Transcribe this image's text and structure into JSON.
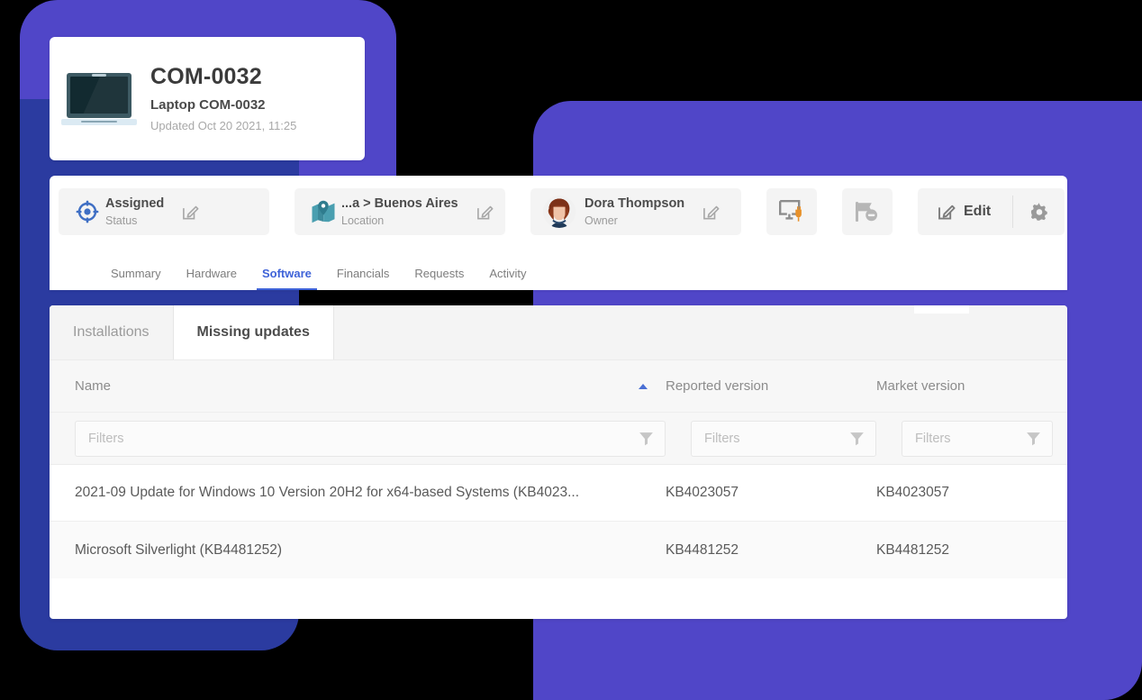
{
  "header": {
    "device_icon": "laptop-icon",
    "title": "COM-0032",
    "subtitle": "Laptop COM-0032",
    "updated": "Updated Oct 20 2021, 11:25"
  },
  "toolbar": {
    "chips": [
      {
        "icon": "target-crosshair-icon",
        "value": "Assigned",
        "label": "Status",
        "edit_icon": "edit-pencil-icon"
      },
      {
        "icon": "map-pin-icon",
        "value": "...a > Buenos Aires",
        "label": "Location",
        "edit_icon": "edit-pencil-icon"
      },
      {
        "icon": "avatar-icon",
        "value": "Dora Thompson",
        "label": "Owner",
        "edit_icon": "edit-pencil-icon"
      }
    ],
    "actions": [
      {
        "name": "monitor-plug-icon",
        "title": ""
      },
      {
        "name": "flag-minus-icon",
        "title": ""
      }
    ],
    "edit_label": "Edit",
    "edit_icon": "edit-pencil-icon",
    "gear_icon": "gear-icon"
  },
  "nav_tabs": [
    {
      "label": "Summary",
      "active": false
    },
    {
      "label": "Hardware",
      "active": false
    },
    {
      "label": "Software",
      "active": true
    },
    {
      "label": "Financials",
      "active": false
    },
    {
      "label": "Requests",
      "active": false
    },
    {
      "label": "Activity",
      "active": false
    }
  ],
  "sub_tabs": [
    {
      "label": "Installations",
      "active": false
    },
    {
      "label": "Missing updates",
      "active": true
    }
  ],
  "table": {
    "columns": [
      {
        "label": "Name",
        "sort": "asc",
        "sort_icon": "sort-ascending-icon"
      },
      {
        "label": "Reported version",
        "sort": "none"
      },
      {
        "label": "Market version",
        "sort": "none"
      }
    ],
    "filters": {
      "placeholder": "Filters",
      "icon": "funnel-filter-icon"
    },
    "rows": [
      {
        "name": "2021-09 Update for Windows 10 Version 20H2 for x64-based Systems (KB4023...",
        "reported_version": "KB4023057",
        "market_version": "KB4023057"
      },
      {
        "name": "Microsoft Silverlight (KB4481252)",
        "reported_version": "KB4481252",
        "market_version": "KB4481252"
      }
    ]
  },
  "colors": {
    "accent_purple": "#5046c8",
    "accent_blue_dark": "#2b3ba0",
    "tab_active": "#3f63d8",
    "sort_arrow": "#4a6fd4",
    "plug_orange": "#e8912a"
  }
}
